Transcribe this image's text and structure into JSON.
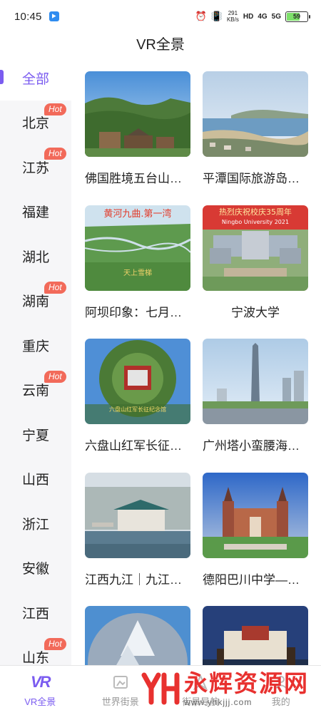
{
  "status_bar": {
    "time": "10:45",
    "speed_value": "291",
    "speed_unit": "KB/s",
    "hd_label": "HD",
    "network_4g": "4G",
    "network_5g": "5G",
    "battery_level": "59",
    "battery_fraction": 0.59
  },
  "header": {
    "title": "VR全景"
  },
  "sidebar": {
    "accent_color": "#7b5cf0",
    "hot_badge_color": "#f26a5a",
    "items": [
      {
        "label": "全部",
        "hot": false,
        "active": true
      },
      {
        "label": "北京",
        "hot": true,
        "hot_label": "Hot"
      },
      {
        "label": "江苏",
        "hot": true,
        "hot_label": "Hot"
      },
      {
        "label": "福建",
        "hot": false
      },
      {
        "label": "湖北",
        "hot": false
      },
      {
        "label": "湖南",
        "hot": true,
        "hot_label": "Hot"
      },
      {
        "label": "重庆",
        "hot": false
      },
      {
        "label": "云南",
        "hot": true,
        "hot_label": "Hot"
      },
      {
        "label": "宁夏",
        "hot": false
      },
      {
        "label": "山西",
        "hot": false
      },
      {
        "label": "浙江",
        "hot": false
      },
      {
        "label": "安徽",
        "hot": false
      },
      {
        "label": "江西",
        "hot": false
      },
      {
        "label": "山东",
        "hot": true,
        "hot_label": "Hot"
      }
    ]
  },
  "cards": [
    {
      "title": "佛国胜境五台山…",
      "image_text": ""
    },
    {
      "title": "平潭国际旅游岛…",
      "image_text": ""
    },
    {
      "title": "阿坝印象：七月…",
      "image_text": "黄河九曲.第一湾",
      "image_text2": "天上雪梯"
    },
    {
      "title": "宁波大学",
      "image_text": "热烈庆祝校庆35周年",
      "image_text2": "Ningbo University 2021"
    },
    {
      "title": "六盘山红军长征…",
      "image_text": "六盘山红军长征纪念馆"
    },
    {
      "title": "广州塔小蛮腰海…",
      "image_text": ""
    },
    {
      "title": "江西九江｜九江…",
      "image_text": ""
    },
    {
      "title": "德阳巴川中学—…",
      "image_text": ""
    },
    {
      "title": "",
      "image_text": ""
    },
    {
      "title": "",
      "image_text": ""
    }
  ],
  "tabbar": {
    "tabs": [
      {
        "label": "VR全景",
        "icon": "vr-icon",
        "active": true
      },
      {
        "label": "世界街景",
        "icon": "map-icon"
      },
      {
        "label": "街景导航",
        "icon": "navigation-icon"
      },
      {
        "label": "我的",
        "icon": "profile-icon"
      }
    ]
  },
  "watermark": {
    "text": "永辉资源网",
    "url": "www.yhkjjj.com"
  }
}
